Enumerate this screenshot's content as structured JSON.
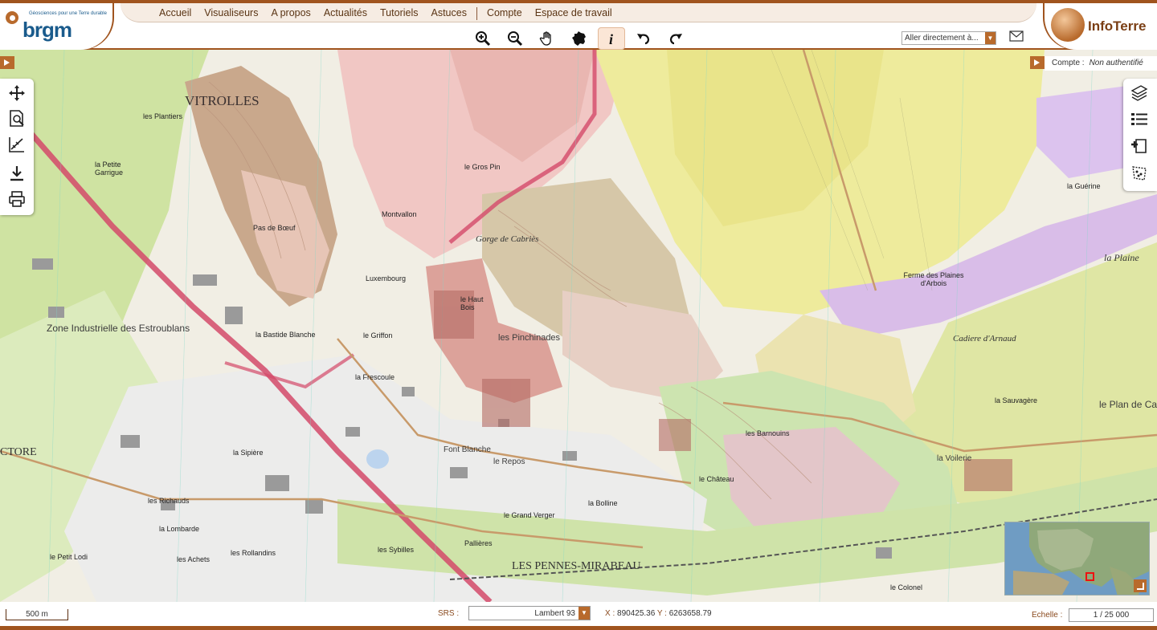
{
  "header": {
    "brgm_tagline": "Géosciences pour une Terre durable",
    "brgm_name": "brgm",
    "app_name": "InfoTerre",
    "nav": [
      "Accueil",
      "Visualiseurs",
      "A propos",
      "Actualités",
      "Tutoriels",
      "Astuces",
      "Compte",
      "Espace de travail"
    ],
    "goto_placeholder": "Aller directement à..."
  },
  "toolbar": {
    "active_tool": "info",
    "icons": [
      "zoom-in-icon",
      "zoom-out-icon",
      "pan-hand-icon",
      "france-map-icon",
      "info-icon",
      "undo-icon",
      "redo-icon"
    ]
  },
  "account": {
    "label": "Compte :",
    "status": "Non authentifié"
  },
  "left_tools": [
    "move-icon",
    "search-document-icon",
    "measure-icon",
    "download-icon",
    "print-icon"
  ],
  "right_tools": [
    "layers-icon",
    "legend-list-icon",
    "add-layer-icon",
    "selection-icon"
  ],
  "map_labels": {
    "vitrolles": "VITROLLES",
    "pennes": "LES PENNES-MIRABEAU",
    "estroublans": "Zone Industrielle des Estroublans",
    "plaines_arbois": "Ferme des Plaines d'Arbois",
    "pinchinades": "les Pinchinades",
    "font_blanche": "Font Blanche",
    "repos": "le Repos",
    "voilerie": "la Voilerie",
    "plan_de_ca": "le Plan de Ca",
    "la_plaine": "la Plaine",
    "gorge": "Gorge de Cabriès",
    "cadiere": "Cadiere d'Arnaud",
    "luxembourg": "Luxembourg",
    "griffon": "le Griffon",
    "bolline": "la Bolline",
    "grand_verger": "le Grand Verger",
    "barnouins": "les Barnouins",
    "chateau": "le Château",
    "montvallon": "Montvallon",
    "sipiere": "la Sipière",
    "richauds": "les Richauds",
    "achets": "les Achets",
    "rollandins": "les Rollandins",
    "petit_lodi": "le Petit Lodi",
    "sybilles": "les Sybilles",
    "pallieres": "Pallières",
    "haut_bois": "le Haut Bois",
    "gros_pin": "le Gros Pin",
    "ctore": "CTORE",
    "frescoule": "la Frescoule",
    "bastide_blanche": "la Bastide Blanche",
    "lombarde": "la Lombarde",
    "colonel": "le Colonel",
    "sauvagere": "la Sauvagère",
    "pas_boeuf": "Pas de Bœuf",
    "guerine": "la Guérine",
    "plantiers": "les Plantiers",
    "petite_garrigue": "la Petite Garrigue"
  },
  "footer": {
    "scale_bar": "500 m",
    "srs_label": "SRS :",
    "srs_value": "Lambert 93",
    "x_label": "X :",
    "x_value": "890425.36",
    "y_label": "Y :",
    "y_value": "6263658.79",
    "scale_label": "Echelle :",
    "scale_value": "1 / 25 000"
  },
  "colors": {
    "brand_brown": "#a0541e",
    "accent_orange": "#b86a2c",
    "brgm_blue": "#1a5b8c"
  }
}
